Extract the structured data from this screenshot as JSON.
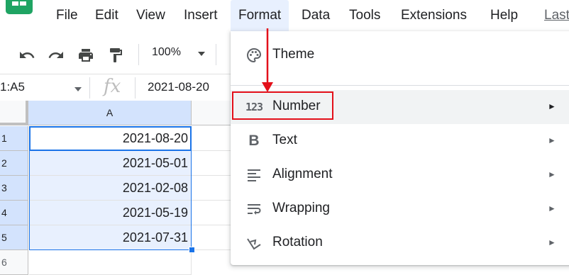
{
  "menu": {
    "items": [
      "File",
      "Edit",
      "View",
      "Insert",
      "Format",
      "Data",
      "Tools",
      "Extensions",
      "Help"
    ],
    "active": "Format",
    "last_edit": "Last"
  },
  "toolbar": {
    "zoom": "100%",
    "icons": [
      "undo-icon",
      "redo-icon",
      "print-icon",
      "paint-format-icon"
    ]
  },
  "formula_bar": {
    "name_box": "1:A5",
    "fx": "fx",
    "value": "2021-08-20"
  },
  "grid": {
    "columns": [
      "A"
    ],
    "rows": [
      {
        "num": "1",
        "a": "2021-08-20"
      },
      {
        "num": "2",
        "a": "2021-05-01"
      },
      {
        "num": "3",
        "a": "2021-02-08"
      },
      {
        "num": "4",
        "a": "2021-05-19"
      },
      {
        "num": "5",
        "a": "2021-07-31"
      },
      {
        "num": "6",
        "a": ""
      }
    ]
  },
  "format_menu": {
    "items": [
      {
        "label": "Theme",
        "icon": "palette-icon",
        "submenu": false
      },
      {
        "label": "Number",
        "icon": "number-123-icon",
        "submenu": true,
        "highlighted": true
      },
      {
        "label": "Text",
        "icon": "bold-icon",
        "submenu": true
      },
      {
        "label": "Alignment",
        "icon": "align-left-icon",
        "submenu": true
      },
      {
        "label": "Wrapping",
        "icon": "wrap-text-icon",
        "submenu": true
      },
      {
        "label": "Rotation",
        "icon": "text-rotation-icon",
        "submenu": true
      }
    ],
    "submenu_arrow": "►",
    "number_icon_text": "123",
    "text_icon_text": "B"
  },
  "colors": {
    "selection_blue": "#1a73e8",
    "annotation_red": "#e3101a",
    "sheets_green": "#1fa463",
    "menu_active_bg": "#e8f0fe"
  }
}
